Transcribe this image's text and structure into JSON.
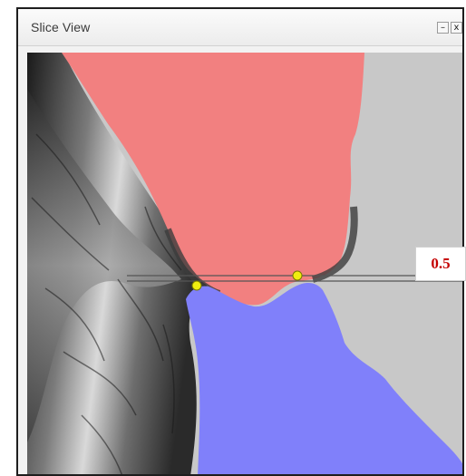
{
  "window": {
    "title": "Slice View",
    "minimize_glyph": "–",
    "close_glyph": "x"
  },
  "overlay": {
    "value_label": "0.5",
    "value_color": "#c40000"
  },
  "colors": {
    "upper_region": "#f28080",
    "lower_region": "#8080fa",
    "background": "#c8c8c8",
    "control_point": "#f0ee10"
  },
  "icons": {
    "minimize": "minimize-icon",
    "close": "close-icon"
  }
}
